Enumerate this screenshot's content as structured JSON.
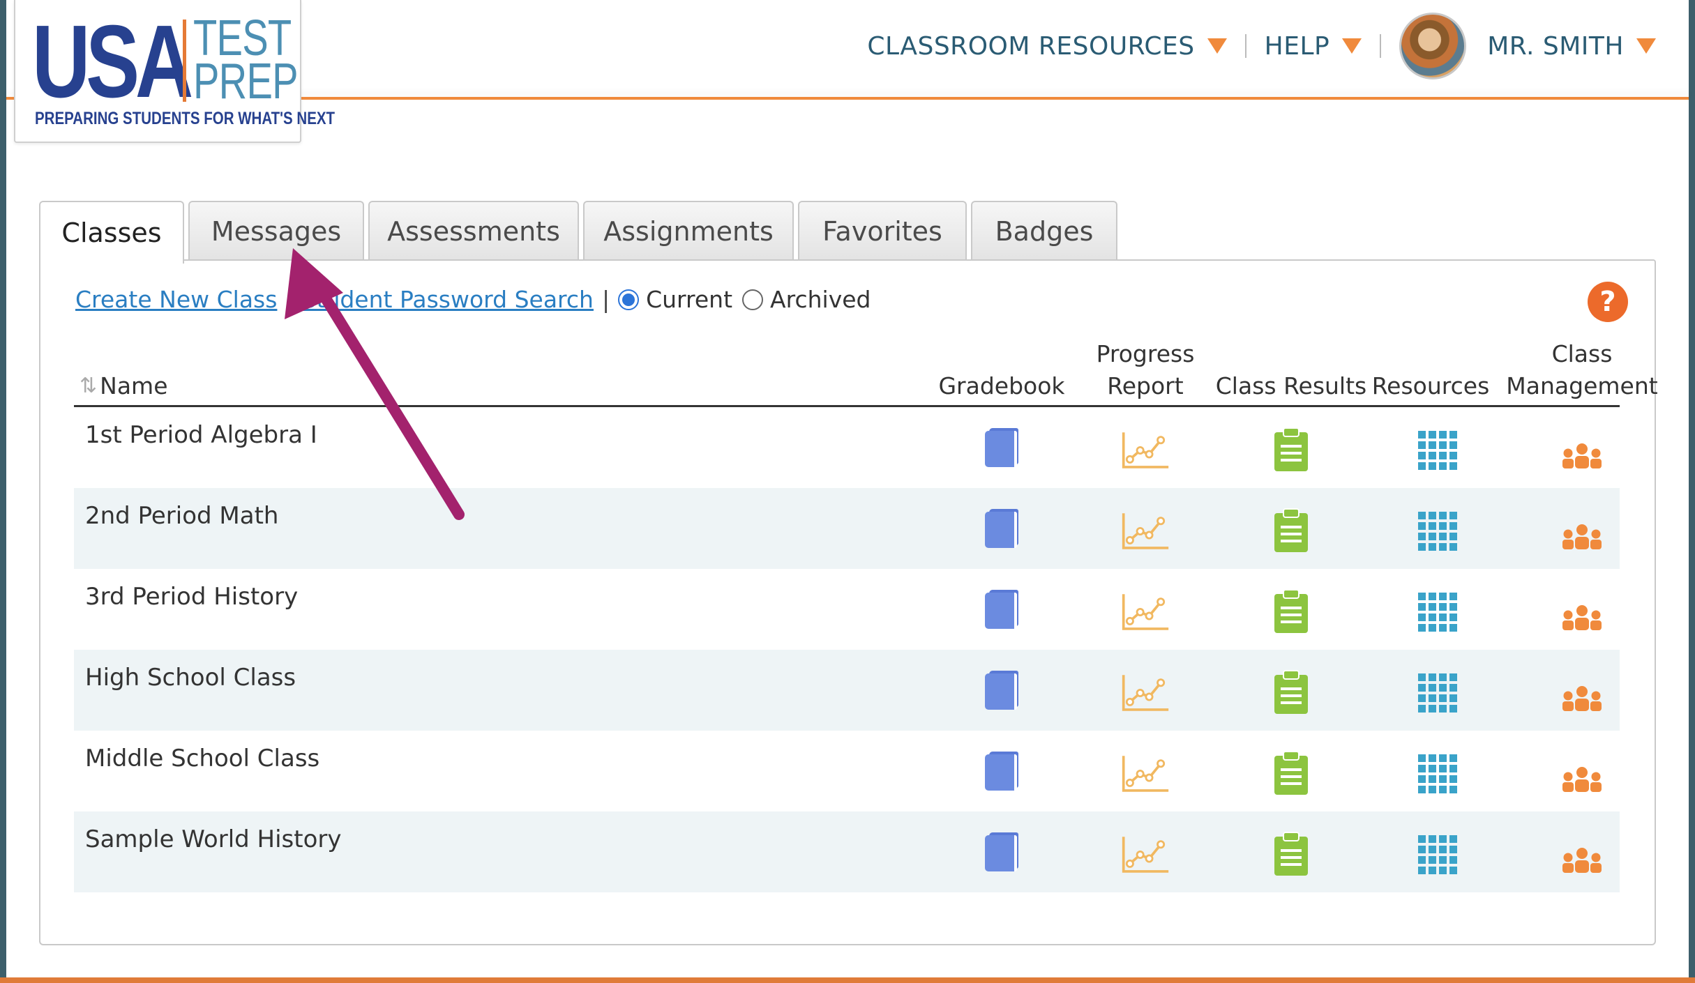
{
  "brand": {
    "logo_usa": "USA",
    "logo_test": "TEST",
    "logo_prep": "PREP",
    "tagline": "PREPARING STUDENTS FOR WHAT'S NEXT",
    "accent_color": "#f08a3c",
    "primary_color": "#27418f"
  },
  "topnav": {
    "classroom_resources": "CLASSROOM RESOURCES",
    "help": "HELP",
    "user": "MR. SMITH"
  },
  "tabs": [
    {
      "label": "Classes",
      "active": true
    },
    {
      "label": "Messages",
      "active": false
    },
    {
      "label": "Assessments",
      "active": false
    },
    {
      "label": "Assignments",
      "active": false
    },
    {
      "label": "Favorites",
      "active": false
    },
    {
      "label": "Badges",
      "active": false
    }
  ],
  "toolbar": {
    "create_class": "Create New Class",
    "separator": "|",
    "password_search": "Student Password Search",
    "current_label": "Current",
    "archived_label": "Archived",
    "selected": "Current",
    "help_symbol": "?"
  },
  "table": {
    "headers": {
      "name": "Name",
      "gradebook": "Gradebook",
      "progress_report_1": "Progress",
      "progress_report_2": "Report",
      "class_results": "Class Results",
      "resources": "Resources",
      "class_management_1": "Class",
      "class_management_2": "Management"
    },
    "rows": [
      {
        "name": "1st Period Algebra I"
      },
      {
        "name": "2nd Period Math"
      },
      {
        "name": "3rd Period History"
      },
      {
        "name": "High School Class"
      },
      {
        "name": "Middle School Class"
      },
      {
        "name": "Sample World History"
      }
    ],
    "icons": {
      "gradebook": "gradebook-icon",
      "progress": "progress-chart-icon",
      "results": "clipboard-icon",
      "resources": "grid-icon",
      "management": "people-icon"
    }
  },
  "annotation": {
    "arrow_color": "#a3226d",
    "target": "Messages"
  }
}
